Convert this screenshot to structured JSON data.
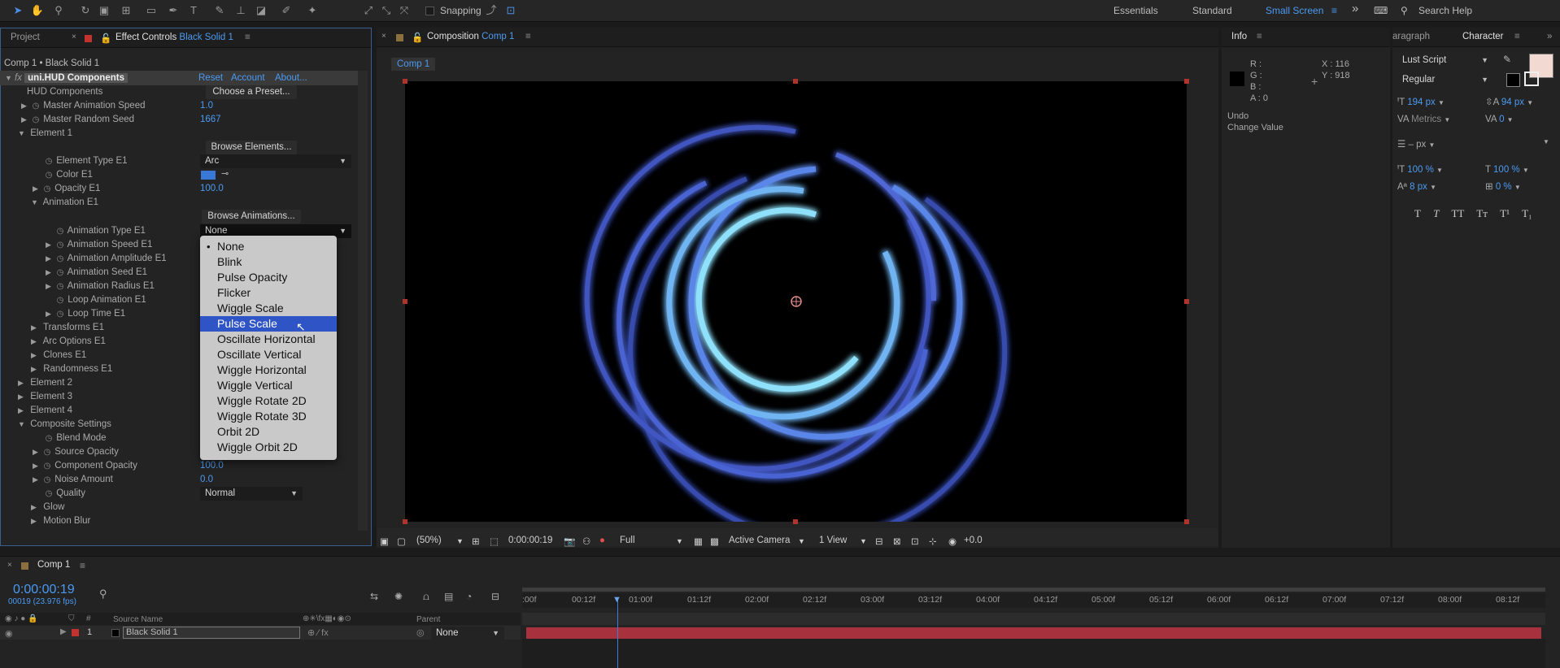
{
  "toolbar": {
    "snapping_label": "Snapping",
    "workspaces": [
      "Essentials",
      "Standard",
      "Small Screen"
    ],
    "search_placeholder": "Search Help",
    "overflow": "»"
  },
  "left_panel": {
    "tab_project": "Project",
    "tab_effect": "Effect Controls",
    "tab_effect_layer": "Black Solid 1",
    "breadcrumb": "Comp 1 • Black Solid 1",
    "effect_name": "uni.HUD Components",
    "reset": "Reset",
    "account": "Account",
    "about": "About...",
    "hud_label": "HUD Components",
    "choose_preset": "Choose a Preset...",
    "browse_elements": "Browse Elements...",
    "browse_animations": "Browse Animations...",
    "properties": [
      {
        "label": "Master Animation Speed",
        "value": "1.0"
      },
      {
        "label": "Master Random Seed",
        "value": "1667"
      },
      {
        "label": "Element 1",
        "value": ""
      },
      {
        "label": "Element Type E1",
        "value": "Arc"
      },
      {
        "label": "Color E1",
        "value": ""
      },
      {
        "label": "Opacity E1",
        "value": "100.0"
      },
      {
        "label": "Animation E1",
        "value": ""
      },
      {
        "label": "Animation Type E1",
        "value": "None"
      },
      {
        "label": "Animation Speed E1",
        "value": ""
      },
      {
        "label": "Animation Amplitude E1",
        "value": ""
      },
      {
        "label": "Animation Seed E1",
        "value": ""
      },
      {
        "label": "Animation Radius E1",
        "value": ""
      },
      {
        "label": "Loop Animation E1",
        "value": ""
      },
      {
        "label": "Loop Time E1",
        "value": ""
      },
      {
        "label": "Transforms E1",
        "value": ""
      },
      {
        "label": "Arc Options E1",
        "value": ""
      },
      {
        "label": "Clones E1",
        "value": ""
      },
      {
        "label": "Randomness E1",
        "value": ""
      },
      {
        "label": "Element 2",
        "value": ""
      },
      {
        "label": "Element 3",
        "value": ""
      },
      {
        "label": "Element 4",
        "value": ""
      },
      {
        "label": "Composite Settings",
        "value": ""
      },
      {
        "label": "Blend Mode",
        "value": ""
      },
      {
        "label": "Source Opacity",
        "value": ""
      },
      {
        "label": "Component Opacity",
        "value": "100.0"
      },
      {
        "label": "Noise Amount",
        "value": "0.0"
      },
      {
        "label": "Quality",
        "value": "Normal"
      },
      {
        "label": "Glow",
        "value": ""
      },
      {
        "label": "Motion Blur",
        "value": ""
      }
    ],
    "color_e1": "#3a78d8"
  },
  "menu": {
    "items": [
      "None",
      "Blink",
      "Pulse Opacity",
      "Flicker",
      "Wiggle Scale",
      "Pulse Scale",
      "Oscillate Horizontal",
      "Oscillate Vertical",
      "Wiggle Horizontal",
      "Wiggle Vertical",
      "Wiggle Rotate 2D",
      "Wiggle Rotate 3D",
      "Orbit 2D",
      "Wiggle Orbit 2D"
    ],
    "checked": "None",
    "highlighted": "Pulse Scale"
  },
  "composition": {
    "tab_prefix": "Composition",
    "tab_name": "Comp 1",
    "breadcrumb": "Comp 1",
    "zoom": "(50%)",
    "timecode": "0:00:00:19",
    "resolution": "Full",
    "camera": "Active Camera",
    "views": "1 View",
    "exposure": "+0.0"
  },
  "info": {
    "title": "Info",
    "r": "R :",
    "g": "G :",
    "b": "B :",
    "a": "A : 0",
    "x": "X : 116",
    "y": "Y : 918",
    "undo": "Undo",
    "change": "Change Value"
  },
  "character": {
    "tab_paragraph": "aragraph",
    "tab_character": "Character",
    "font": "Lust Script",
    "style": "Regular",
    "size": "194 px",
    "leading": "94 px",
    "kerning": "Metrics",
    "tracking": "0",
    "stroke": "– px",
    "vscale": "100 %",
    "hscale": "100 %",
    "baseline": "8 px",
    "tsume": "0 %",
    "fill_color": "#f2d9d2",
    "styles": [
      "T",
      "T",
      "TT",
      "Tт",
      "T¹",
      "T₁"
    ]
  },
  "timeline": {
    "tab": "Comp 1",
    "timecode": "0:00:00:19",
    "frames": "00019 (23.976 fps)",
    "col_source": "Source Name",
    "col_parent": "Parent",
    "layer_num": "1",
    "layer_name": "Black Solid 1",
    "parent_value": "None",
    "ticks": [
      ":00f",
      "00:12f",
      "01:00f",
      "01:12f",
      "02:00f",
      "02:12f",
      "03:00f",
      "03:12f",
      "04:00f",
      "04:12f",
      "05:00f",
      "05:12f",
      "06:00f",
      "06:12f",
      "07:00f",
      "07:12f",
      "08:00f",
      "08:12f"
    ]
  }
}
